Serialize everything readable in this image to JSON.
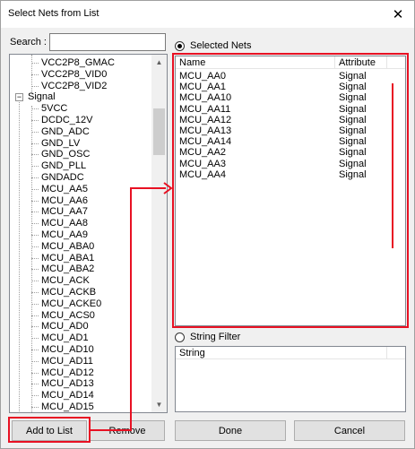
{
  "window": {
    "title": "Select Nets from List",
    "close_glyph": "✕"
  },
  "search": {
    "label": "Search :",
    "value": "",
    "placeholder": ""
  },
  "tree": {
    "rows": [
      {
        "label": "VCC2P8_GMAC",
        "level": 2
      },
      {
        "label": "VCC2P8_VID0",
        "level": 2
      },
      {
        "label": "VCC2P8_VID2",
        "level": 2
      },
      {
        "label": "Signal",
        "level": 1,
        "expander": "−"
      },
      {
        "label": "5VCC",
        "level": 2
      },
      {
        "label": "DCDC_12V",
        "level": 2
      },
      {
        "label": "GND_ADC",
        "level": 2
      },
      {
        "label": "GND_LV",
        "level": 2
      },
      {
        "label": "GND_OSC",
        "level": 2
      },
      {
        "label": "GND_PLL",
        "level": 2
      },
      {
        "label": "GNDADC",
        "level": 2
      },
      {
        "label": "MCU_AA5",
        "level": 2
      },
      {
        "label": "MCU_AA6",
        "level": 2
      },
      {
        "label": "MCU_AA7",
        "level": 2
      },
      {
        "label": "MCU_AA8",
        "level": 2
      },
      {
        "label": "MCU_AA9",
        "level": 2
      },
      {
        "label": "MCU_ABA0",
        "level": 2
      },
      {
        "label": "MCU_ABA1",
        "level": 2
      },
      {
        "label": "MCU_ABA2",
        "level": 2
      },
      {
        "label": "MCU_ACK",
        "level": 2
      },
      {
        "label": "MCU_ACKB",
        "level": 2
      },
      {
        "label": "MCU_ACKE0",
        "level": 2
      },
      {
        "label": "MCU_ACS0",
        "level": 2
      },
      {
        "label": "MCU_AD0",
        "level": 2
      },
      {
        "label": "MCU_AD1",
        "level": 2
      },
      {
        "label": "MCU_AD10",
        "level": 2
      },
      {
        "label": "MCU_AD11",
        "level": 2
      },
      {
        "label": "MCU_AD12",
        "level": 2
      },
      {
        "label": "MCU_AD13",
        "level": 2
      },
      {
        "label": "MCU_AD14",
        "level": 2
      },
      {
        "label": "MCU_AD15",
        "level": 2
      }
    ],
    "scroll_up_glyph": "▲",
    "scroll_down_glyph": "▼"
  },
  "selected_nets": {
    "radio_label": "Selected Nets",
    "radio_checked": true,
    "columns": [
      "Name",
      "Attribute"
    ],
    "rows": [
      {
        "name": "MCU_AA0",
        "attribute": "Signal"
      },
      {
        "name": "MCU_AA1",
        "attribute": "Signal"
      },
      {
        "name": "MCU_AA10",
        "attribute": "Signal"
      },
      {
        "name": "MCU_AA11",
        "attribute": "Signal"
      },
      {
        "name": "MCU_AA12",
        "attribute": "Signal"
      },
      {
        "name": "MCU_AA13",
        "attribute": "Signal"
      },
      {
        "name": "MCU_AA14",
        "attribute": "Signal"
      },
      {
        "name": "MCU_AA2",
        "attribute": "Signal"
      },
      {
        "name": "MCU_AA3",
        "attribute": "Signal"
      },
      {
        "name": "MCU_AA4",
        "attribute": "Signal"
      }
    ]
  },
  "string_filter": {
    "radio_label": "String Filter",
    "radio_checked": false,
    "columns": [
      "String"
    ]
  },
  "buttons": {
    "add_to_list": "Add to List",
    "remove": "Remove",
    "done": "Done",
    "cancel": "Cancel"
  },
  "colors": {
    "highlight": "#e81123",
    "window_bg": "#f0f0f0"
  }
}
